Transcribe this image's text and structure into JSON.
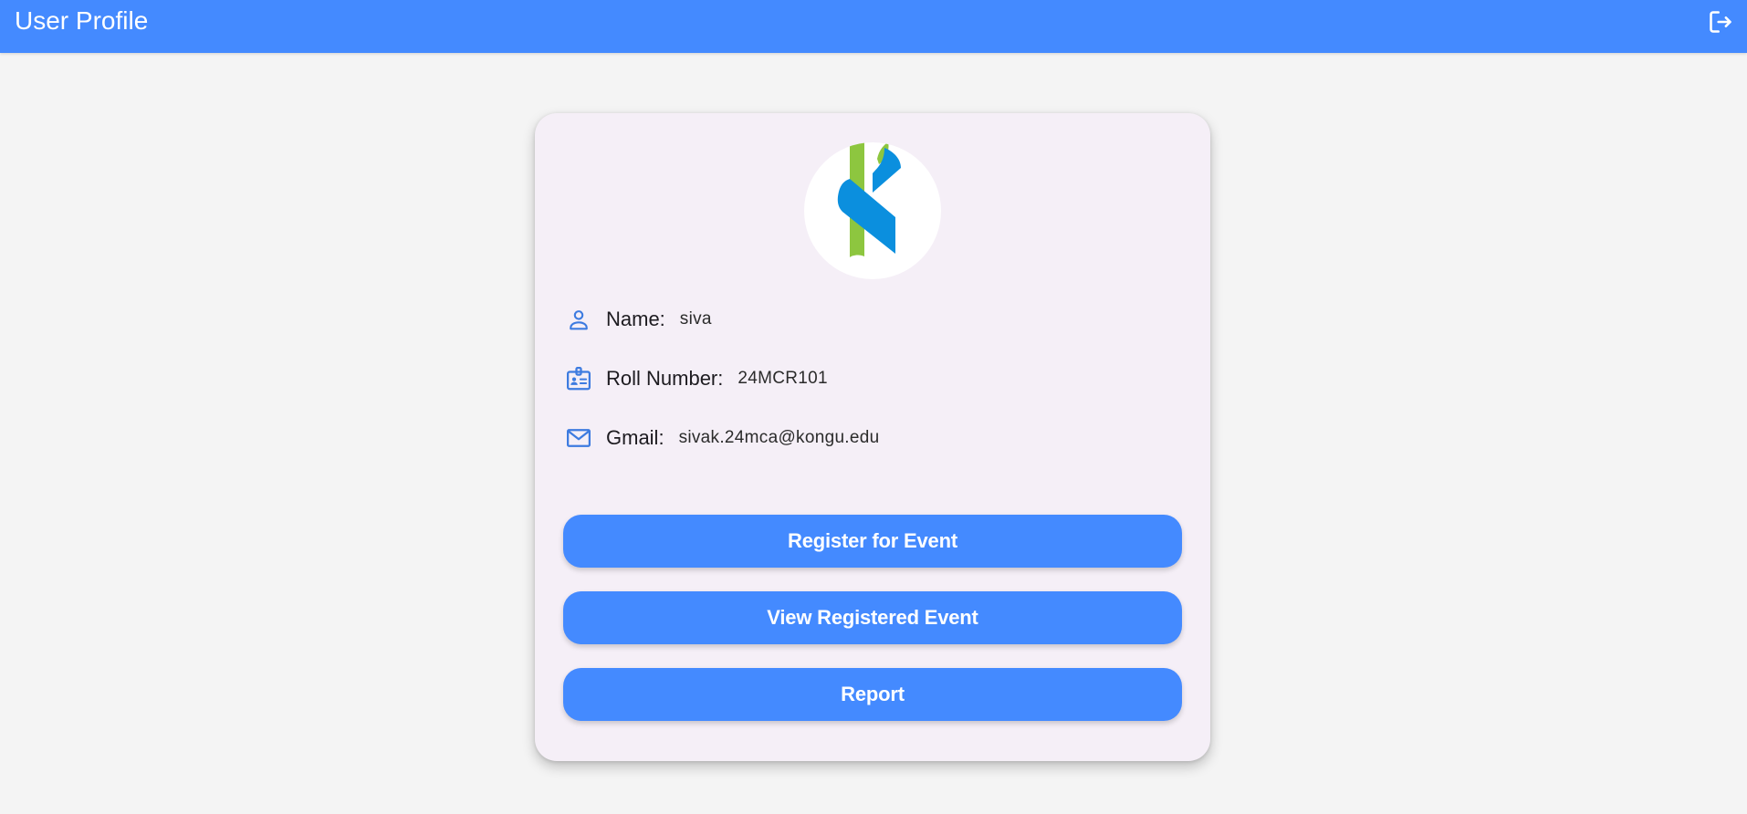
{
  "app_bar": {
    "title": "User Profile",
    "logout_icon": "logout-icon",
    "color": "#448aff"
  },
  "profile": {
    "avatar_icon": "kongu-logo",
    "fields": [
      {
        "icon": "person-icon",
        "label": "Name:",
        "value": "siva"
      },
      {
        "icon": "badge-icon",
        "label": "Roll Number:",
        "value": "24MCR101"
      },
      {
        "icon": "mail-icon",
        "label": "Gmail:",
        "value": "sivak.24mca@kongu.edu"
      }
    ]
  },
  "actions": {
    "register_label": "Register for Event",
    "view_registered_label": "View Registered Event",
    "report_label": "Report"
  },
  "colors": {
    "accent": "#448aff",
    "background": "#f4f4f4",
    "card": "#f5eff7",
    "logo_green": "#8dc63f",
    "logo_blue": "#0b8fde"
  }
}
